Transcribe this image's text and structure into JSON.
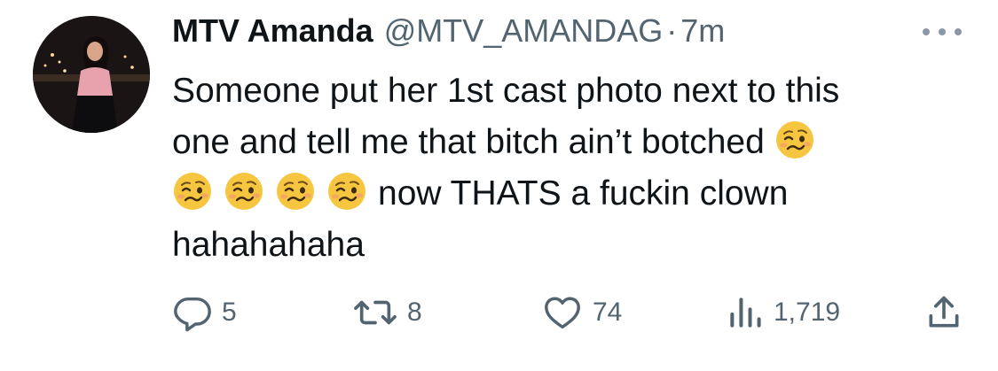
{
  "tweet": {
    "author_name": "MTV Amanda",
    "handle": "@MTV_AMANDAG",
    "separator": "·",
    "time": "7m",
    "text_line1": "Someone put her 1st cast photo next to this",
    "text_line2": "one and tell me that bitch ain’t botched",
    "text_line3": "now THATS a fuckin clown",
    "text_line4": "hahahahaha",
    "emoji_name": "woozy-face",
    "counts": {
      "replies": "5",
      "retweets": "8",
      "likes": "74",
      "views": "1,719"
    }
  },
  "icons": {
    "more": "more-dots-icon",
    "reply": "reply-icon",
    "retweet": "retweet-icon",
    "like": "heart-icon",
    "views": "views-icon",
    "share": "share-icon"
  },
  "colors": {
    "text": "#0f1419",
    "secondary": "#536471",
    "emoji_yellow": "#f7c640"
  }
}
